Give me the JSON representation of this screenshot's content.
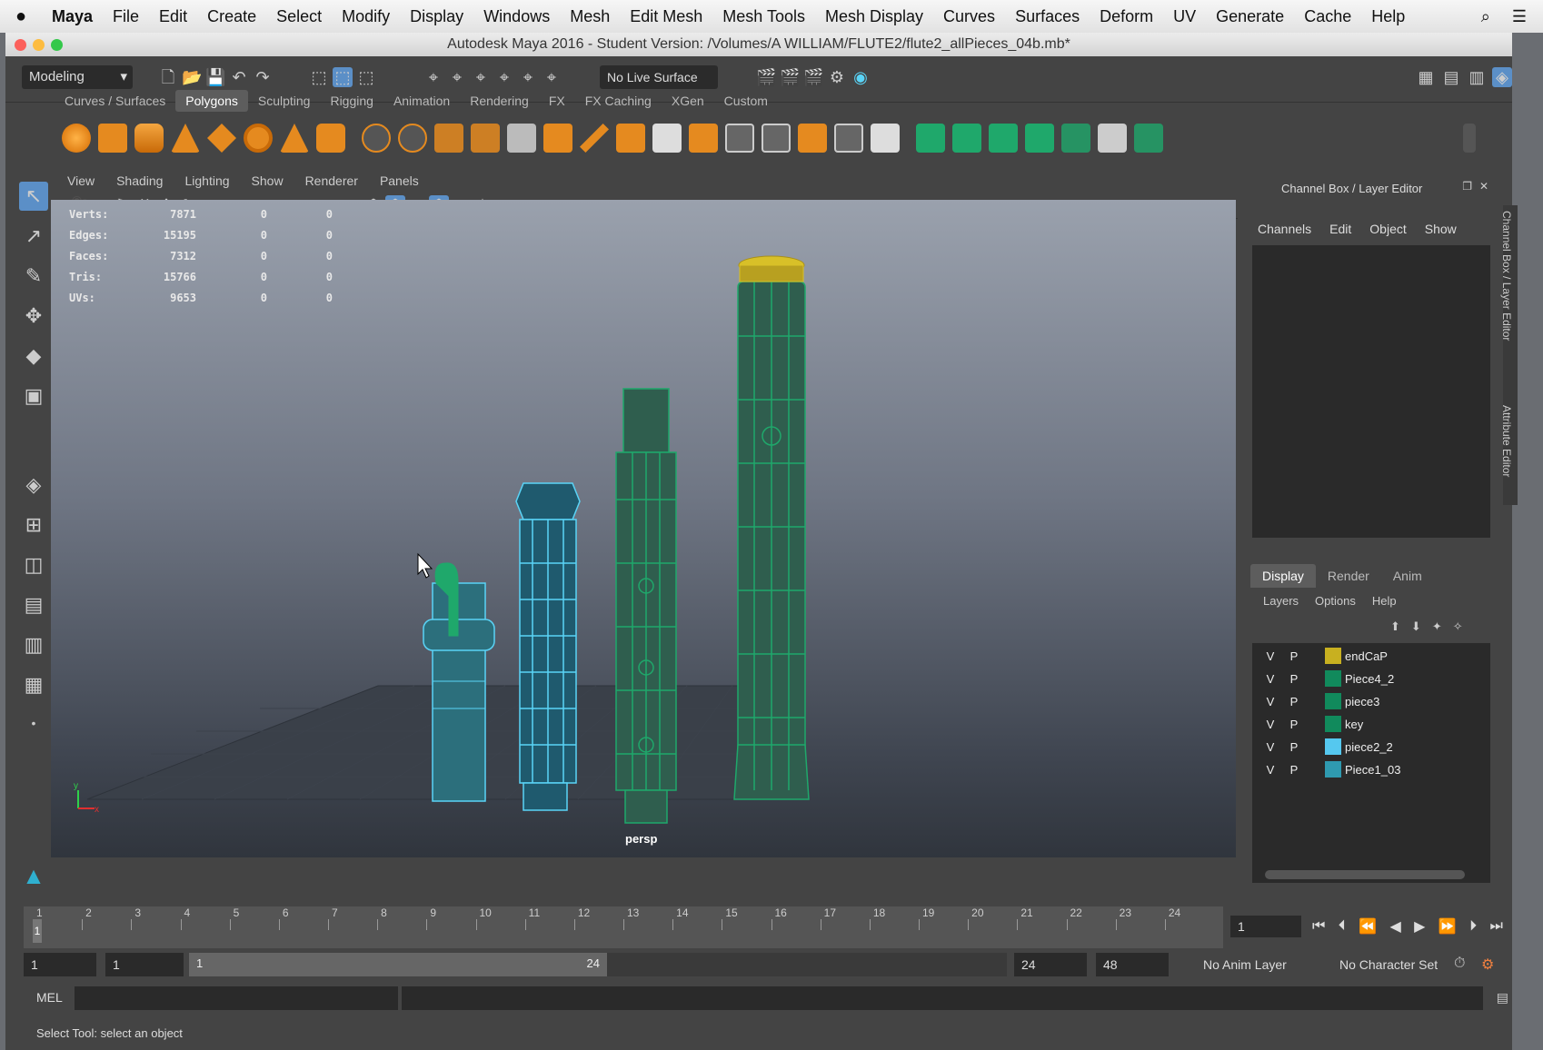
{
  "macmenu": {
    "app": "Maya",
    "items": [
      "File",
      "Edit",
      "Create",
      "Select",
      "Modify",
      "Display",
      "Windows",
      "Mesh",
      "Edit Mesh",
      "Mesh Tools",
      "Mesh Display",
      "Curves",
      "Surfaces",
      "Deform",
      "UV",
      "Generate",
      "Cache",
      "Help"
    ]
  },
  "window": {
    "title": "Autodesk Maya 2016 - Student Version: /Volumes/A WILLIAM/FLUTE2/flute2_allPieces_04b.mb*"
  },
  "statusline": {
    "mode": "Modeling",
    "live_surface": "No Live Surface"
  },
  "shelf": {
    "tabs": [
      "Curves / Surfaces",
      "Polygons",
      "Sculpting",
      "Rigging",
      "Animation",
      "Rendering",
      "FX",
      "FX Caching",
      "XGen",
      "Custom"
    ],
    "active_tab": "Polygons"
  },
  "viewport": {
    "menu": [
      "View",
      "Shading",
      "Lighting",
      "Show",
      "Renderer",
      "Panels"
    ],
    "camera": "persp",
    "hud": [
      {
        "label": "Verts:",
        "v1": "7871",
        "v2": "0",
        "v3": "0"
      },
      {
        "label": "Edges:",
        "v1": "15195",
        "v2": "0",
        "v3": "0"
      },
      {
        "label": "Faces:",
        "v1": "7312",
        "v2": "0",
        "v3": "0"
      },
      {
        "label": "Tris:",
        "v1": "15766",
        "v2": "0",
        "v3": "0"
      },
      {
        "label": "UVs:",
        "v1": "9653",
        "v2": "0",
        "v3": "0"
      }
    ]
  },
  "channel_box": {
    "title": "Channel Box / Layer Editor",
    "menu": [
      "Channels",
      "Edit",
      "Object",
      "Show"
    ],
    "side_tabs": [
      "Channel Box / Layer Editor",
      "Attribute Editor"
    ]
  },
  "layer_editor": {
    "tabs": [
      "Display",
      "Render",
      "Anim"
    ],
    "active_tab": "Display",
    "menu": [
      "Layers",
      "Options",
      "Help"
    ],
    "layers": [
      {
        "v": "V",
        "p": "P",
        "name": "endCaP",
        "color": "#c8b020"
      },
      {
        "v": "V",
        "p": "P",
        "name": "Piece4_2",
        "color": "#118a5c"
      },
      {
        "v": "V",
        "p": "P",
        "name": "piece3",
        "color": "#118a5c"
      },
      {
        "v": "V",
        "p": "P",
        "name": "key",
        "color": "#118a5c"
      },
      {
        "v": "V",
        "p": "P",
        "name": "piece2_2",
        "color": "#55c8ef"
      },
      {
        "v": "V",
        "p": "P",
        "name": "Piece1_03",
        "color": "#2f9ab0"
      }
    ]
  },
  "timeline": {
    "ticks": [
      "1",
      "2",
      "3",
      "4",
      "5",
      "6",
      "7",
      "8",
      "9",
      "10",
      "11",
      "12",
      "13",
      "14",
      "15",
      "16",
      "17",
      "18",
      "19",
      "20",
      "21",
      "22",
      "23",
      "24"
    ],
    "current_frame": "1",
    "range_start": "1",
    "playback_start": "1",
    "range_bar_start": "1",
    "range_bar_end": "24",
    "playback_end": "24",
    "range_end": "48",
    "anim_layer": "No Anim Layer",
    "character_set": "No Character Set"
  },
  "command_line": {
    "label": "MEL"
  },
  "help_line": {
    "text": "Select Tool: select an object"
  },
  "colors": {
    "mesh_green": "#1fa86b",
    "mesh_blue": "#5ad4f7",
    "mesh_yellow": "#d8c028"
  }
}
